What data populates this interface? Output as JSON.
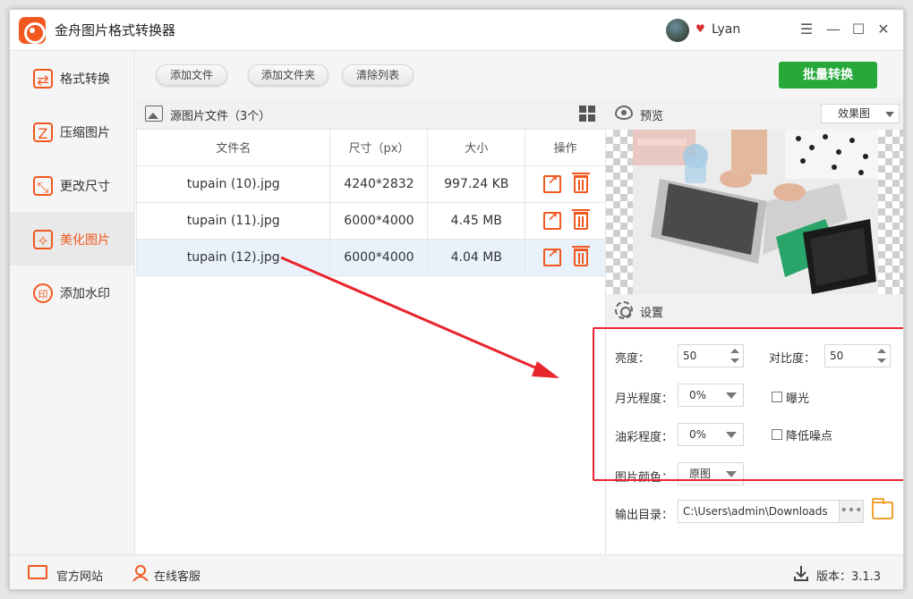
{
  "app": {
    "title": "金舟图片格式转换器",
    "user": "Lyan"
  },
  "window_controls": {
    "menu": "☰",
    "minimize": "—",
    "maximize": "☐",
    "close": "✕"
  },
  "sidebar": {
    "items": [
      {
        "label": "格式转换",
        "icon": "format-convert-icon"
      },
      {
        "label": "压缩图片",
        "icon": "compress-icon"
      },
      {
        "label": "更改尺寸",
        "icon": "resize-icon"
      },
      {
        "label": "美化图片",
        "icon": "beautify-icon",
        "active": true
      },
      {
        "label": "添加水印",
        "icon": "watermark-icon"
      }
    ]
  },
  "toolbar": {
    "add_file": "添加文件",
    "add_folder": "添加文件夹",
    "clear_list": "清除列表",
    "batch_convert": "批量转换"
  },
  "files": {
    "title": "源图片文件（3个）",
    "columns": [
      "文件名",
      "尺寸（px）",
      "大小",
      "操作"
    ],
    "rows": [
      {
        "name": "tupain (10).jpg",
        "size_px": "4240*2832",
        "size": "997.24 KB"
      },
      {
        "name": "tupain (11).jpg",
        "size_px": "6000*4000",
        "size": "4.45 MB"
      },
      {
        "name": "tupain (12).jpg",
        "size_px": "6000*4000",
        "size": "4.04 MB",
        "selected": true
      }
    ]
  },
  "preview": {
    "title": "预览",
    "mode": "效果图"
  },
  "settings": {
    "title": "设置",
    "brightness_label": "亮度：",
    "brightness": "50",
    "contrast_label": "对比度：",
    "contrast": "50",
    "moonlight_label": "月光程度：",
    "moonlight": "0%",
    "exposure_label": "曝光",
    "oil_label": "油彩程度：",
    "oil": "0%",
    "denoise_label": "降低噪点",
    "color_label": "图片颜色：",
    "color": "原图"
  },
  "output": {
    "label": "输出目录：",
    "path": "C:\\Users\\admin\\Downloads",
    "browse": "•••"
  },
  "footer": {
    "website": "官方网站",
    "support": "在线客服",
    "version": "版本：3.1.3"
  },
  "colors": {
    "accent": "#f0581f",
    "green": "#27a93a",
    "highlight_red": "#e8242c"
  }
}
